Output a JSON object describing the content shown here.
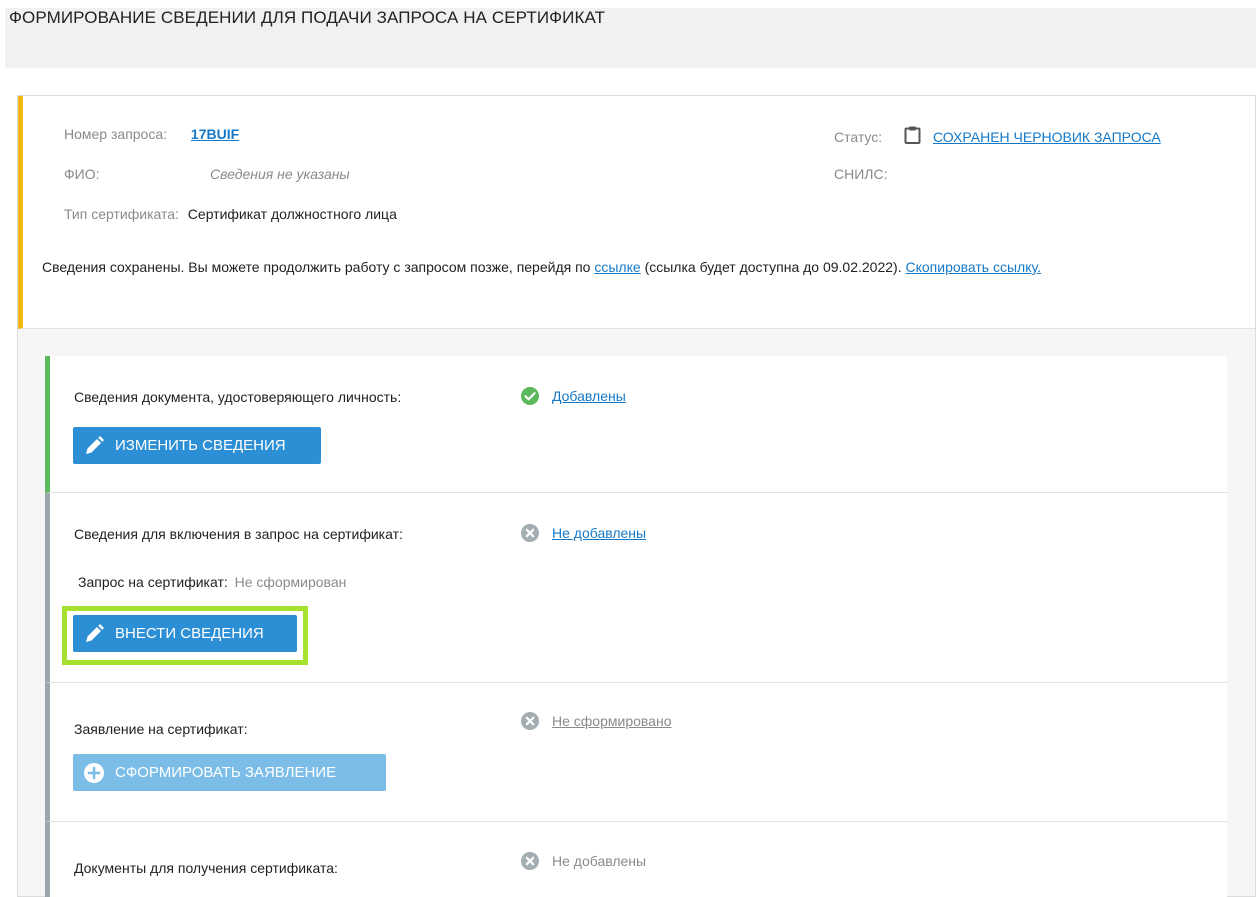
{
  "page": {
    "title": "ФОРМИРОВАНИЕ СВЕДЕНИИ ДЛЯ ПОДАЧИ ЗАПРОСА НА СЕРТИФИКАТ"
  },
  "request_info": {
    "number_label": "Номер запроса:",
    "number_value": "17BUIF",
    "status_label": "Статус:",
    "status_value": "СОХРАНЕН ЧЕРНОВИК ЗАПРОСА",
    "fio_label": "ФИО:",
    "fio_value": "Сведения не указаны",
    "snils_label": "СНИЛС:",
    "cert_type_label": "Тип сертификата:",
    "cert_type_value": "Сертификат должностного лица",
    "notice_text_1": "Сведения сохранены. Вы можете продолжить работу с запросом позже, перейдя по",
    "notice_link": "ссылке",
    "notice_text_2": "(ссылка будет доступна до 09.02.2022).",
    "copy_link": "Скопировать ссылку."
  },
  "sections": {
    "identity": {
      "label": "Сведения документа, удостоверяющего личность:",
      "status": "Добавлены",
      "button": "ИЗМЕНИТЬ СВЕДЕНИЯ"
    },
    "cert_request": {
      "label": "Сведения для включения в запрос на сертификат:",
      "status": "Не добавлены",
      "sub_label": "Запрос на сертификат:",
      "sub_value": "Не сформирован",
      "button": "ВНЕСТИ СВЕДЕНИЯ"
    },
    "application": {
      "label": "Заявление на сертификат:",
      "status": "Не сформировано",
      "button": "СФОРМИРОВАТЬ ЗАЯВЛЕНИЕ"
    },
    "documents": {
      "label": "Документы для получения сертификата:",
      "status": "Не добавлены"
    }
  },
  "colors": {
    "accent_blue": "#2c8fd6",
    "link_blue": "#1679c8",
    "warning_yellow": "#f4b915",
    "success_green": "#5cb85c",
    "highlight_green": "#a6e12d",
    "muted_gray": "#9ba6ab"
  },
  "icons": {
    "status": "clipboard-icon",
    "added": "check-circle-icon",
    "not_added": "x-circle-icon",
    "edit": "pencil-icon",
    "create": "plus-circle-icon"
  }
}
